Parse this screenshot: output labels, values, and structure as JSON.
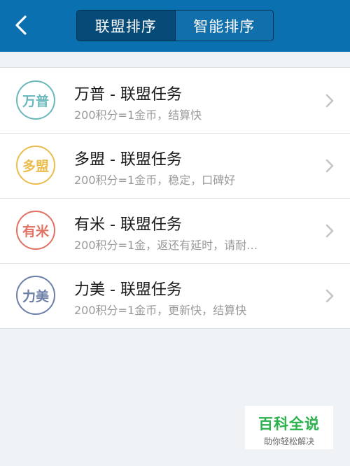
{
  "header": {
    "back_icon": "chevron-left-icon",
    "tabs": [
      {
        "label": "联盟排序",
        "selected": true
      },
      {
        "label": "智能排序",
        "selected": false
      }
    ]
  },
  "items": [
    {
      "badge": "万普",
      "color": "#6bb8bb",
      "title": "万普 - 联盟任务",
      "subtitle": "200积分=1金币，结算快"
    },
    {
      "badge": "多盟",
      "color": "#eabd4d",
      "title": "多盟 - 联盟任务",
      "subtitle": "200积分=1金币，稳定，口碑好"
    },
    {
      "badge": "有米",
      "color": "#e27063",
      "title": "有米 - 联盟任务",
      "subtitle": "200积分=1金，返还有延时，请耐…"
    },
    {
      "badge": "力美",
      "color": "#6c7fa8",
      "title": "力美 - 联盟任务",
      "subtitle": "200积分=1金币，更新快，结算快"
    }
  ],
  "watermark": {
    "main": "百科全说",
    "sub": "助你轻松解决"
  }
}
